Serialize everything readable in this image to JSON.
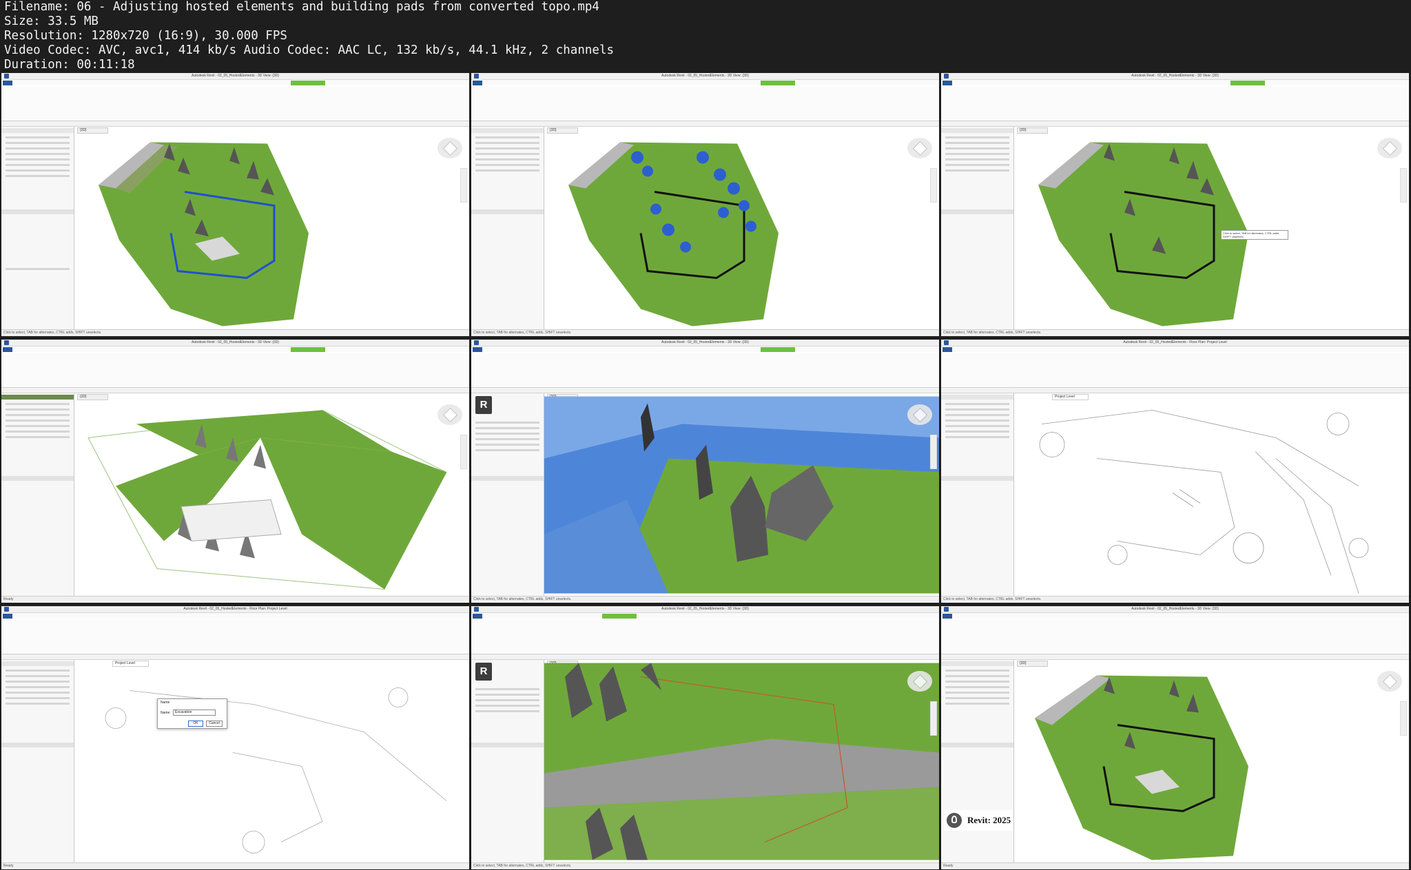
{
  "info": {
    "filename": "Filename: 06 - Adjusting hosted elements and building pads from converted topo.mp4",
    "size": "Size: 33.5 MB",
    "resolution": "Resolution: 1280x720 (16:9), 30.000 FPS",
    "codecs": "Video Codec: AVC, avc1, 414 kb/s Audio Codec: AAC LC, 132 kb/s, 44.1 kHz, 2 channels",
    "duration": "Duration: 00:11:18"
  },
  "thumbnails": [
    {
      "id": "t1",
      "view": "3d-railing-selected",
      "tab": "{3D}",
      "title": "Autodesk Revit - 02_05_HostedElements - 3D View: {3D}",
      "status": "Click to select, TAB for alternates, CTRL adds, SHIFT unselects."
    },
    {
      "id": "t2",
      "view": "3d-multiple-selected",
      "tab": "{3D}",
      "title": "Autodesk Revit - 02_05_HostedElements - 3D View: {3D}",
      "status": "Click to select, TAB for alternates, CTRL adds, SHIFT unselects."
    },
    {
      "id": "t3",
      "view": "3d-parking-tooltip",
      "tab": "{3D}",
      "title": "Autodesk Revit - 02_05_HostedElements - 3D View: {3D}",
      "status": "Click to select, TAB for alternates, CTRL adds, SHIFT unselects.",
      "tooltip": "Click to select, TAB for alternates, CTRL adds, SHIFT unselects."
    },
    {
      "id": "t4",
      "view": "3d-toposolid",
      "tab": "{3D}",
      "title": "Autodesk Revit - 02_05_HostedElements - 3D View: {3D}",
      "status": "Ready"
    },
    {
      "id": "t5",
      "view": "3d-closeup-blue",
      "tab": "{3D}",
      "title": "Autodesk Revit - 02_05_HostedElements - 3D View: {3D}",
      "status": "Click to select, TAB for alternates, CTRL adds, SHIFT unselects.",
      "badge": "R"
    },
    {
      "id": "t6",
      "view": "plan-linework",
      "tab": "Project Level",
      "title": "Autodesk Revit - 02_05_HostedElements - Floor Plan: Project Level",
      "status": "Click to select, TAB for alternates, CTRL adds, SHIFT unselects."
    },
    {
      "id": "t7",
      "view": "plan-dialog",
      "tab": "Project Level",
      "title": "Autodesk Revit - 02_05_HostedElements - Floor Plan: Project Level",
      "status": "Ready",
      "dialog": {
        "title": "Name",
        "label": "Name:",
        "value": "Excavation",
        "ok": "OK",
        "cancel": "Cancel"
      }
    },
    {
      "id": "t8",
      "view": "3d-closeup-green",
      "tab": "{3D}",
      "title": "Autodesk Revit - 02_05_HostedElements - 3D View: {3D}",
      "status": "Click to select, TAB for alternates, CTRL adds, SHIFT unselects.",
      "badge": "R"
    },
    {
      "id": "t9",
      "view": "3d-final",
      "tab": "{3D}",
      "title": "Autodesk Revit - 02_05_HostedElements - 3D View: {3D}",
      "status": "Ready",
      "badge_text": "Revit: 2025"
    }
  ],
  "colors": {
    "terrain": "#6fa83a",
    "road": "#b8b8b8",
    "selection": "#1f4fd1",
    "water": "#4d86d9",
    "ribbon_accent": "#2b579a"
  }
}
